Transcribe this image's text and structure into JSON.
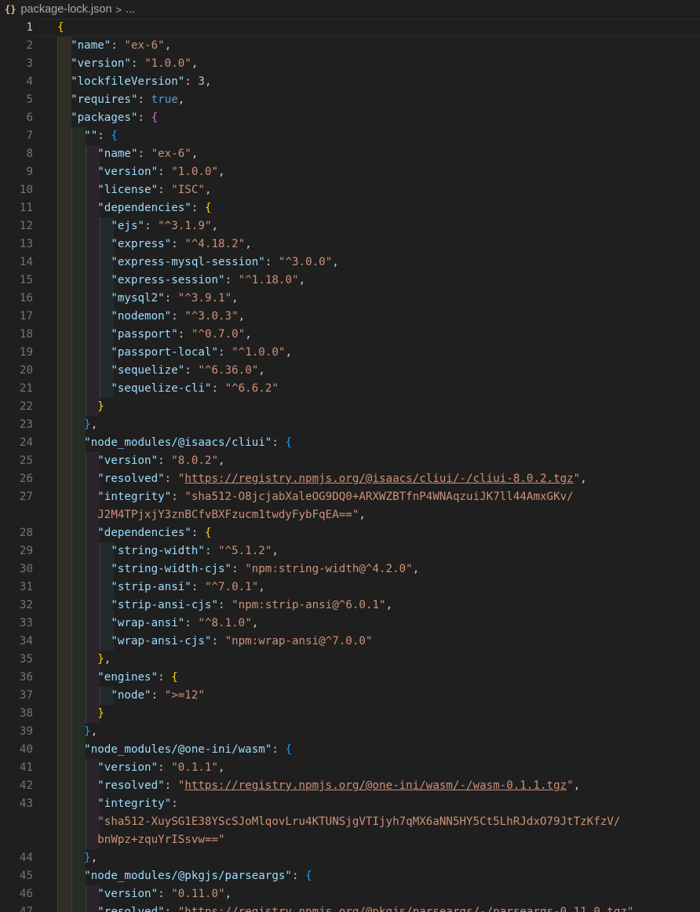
{
  "breadcrumb": {
    "icon": "{}",
    "file": "package-lock.json",
    "separator": ">",
    "more": "..."
  },
  "lines": [
    {
      "n": "1",
      "d": 0,
      "active": true,
      "tokens": [
        [
          "br1",
          "{"
        ]
      ]
    },
    {
      "n": "2",
      "d": 1,
      "tokens": [
        [
          "k",
          "\"name\""
        ],
        [
          "p",
          ": "
        ],
        [
          "s",
          "\"ex-6\""
        ],
        [
          "p",
          ","
        ]
      ]
    },
    {
      "n": "3",
      "d": 1,
      "tokens": [
        [
          "k",
          "\"version\""
        ],
        [
          "p",
          ": "
        ],
        [
          "s",
          "\"1.0.0\""
        ],
        [
          "p",
          ","
        ]
      ]
    },
    {
      "n": "4",
      "d": 1,
      "tokens": [
        [
          "k",
          "\"lockfileVersion\""
        ],
        [
          "p",
          ": "
        ],
        [
          "n",
          "3"
        ],
        [
          "p",
          ","
        ]
      ]
    },
    {
      "n": "5",
      "d": 1,
      "tokens": [
        [
          "k",
          "\"requires\""
        ],
        [
          "p",
          ": "
        ],
        [
          "b",
          "true"
        ],
        [
          "p",
          ","
        ]
      ]
    },
    {
      "n": "6",
      "d": 1,
      "tokens": [
        [
          "k",
          "\"packages\""
        ],
        [
          "p",
          ": "
        ],
        [
          "br2",
          "{"
        ]
      ]
    },
    {
      "n": "7",
      "d": 2,
      "tokens": [
        [
          "k",
          "\"\""
        ],
        [
          "p",
          ": "
        ],
        [
          "br3",
          "{"
        ]
      ]
    },
    {
      "n": "8",
      "d": 3,
      "tokens": [
        [
          "k",
          "\"name\""
        ],
        [
          "p",
          ": "
        ],
        [
          "s",
          "\"ex-6\""
        ],
        [
          "p",
          ","
        ]
      ]
    },
    {
      "n": "9",
      "d": 3,
      "tokens": [
        [
          "k",
          "\"version\""
        ],
        [
          "p",
          ": "
        ],
        [
          "s",
          "\"1.0.0\""
        ],
        [
          "p",
          ","
        ]
      ]
    },
    {
      "n": "10",
      "d": 3,
      "tokens": [
        [
          "k",
          "\"license\""
        ],
        [
          "p",
          ": "
        ],
        [
          "s",
          "\"ISC\""
        ],
        [
          "p",
          ","
        ]
      ]
    },
    {
      "n": "11",
      "d": 3,
      "tokens": [
        [
          "k",
          "\"dependencies\""
        ],
        [
          "p",
          ": "
        ],
        [
          "br1",
          "{"
        ]
      ]
    },
    {
      "n": "12",
      "d": 4,
      "tokens": [
        [
          "k",
          "\"ejs\""
        ],
        [
          "p",
          ": "
        ],
        [
          "s",
          "\"^3.1.9\""
        ],
        [
          "p",
          ","
        ]
      ]
    },
    {
      "n": "13",
      "d": 4,
      "tokens": [
        [
          "k",
          "\"express\""
        ],
        [
          "p",
          ": "
        ],
        [
          "s",
          "\"^4.18.2\""
        ],
        [
          "p",
          ","
        ]
      ]
    },
    {
      "n": "14",
      "d": 4,
      "tokens": [
        [
          "k",
          "\"express-mysql-session\""
        ],
        [
          "p",
          ": "
        ],
        [
          "s",
          "\"^3.0.0\""
        ],
        [
          "p",
          ","
        ]
      ]
    },
    {
      "n": "15",
      "d": 4,
      "tokens": [
        [
          "k",
          "\"express-session\""
        ],
        [
          "p",
          ": "
        ],
        [
          "s",
          "\"^1.18.0\""
        ],
        [
          "p",
          ","
        ]
      ]
    },
    {
      "n": "16",
      "d": 4,
      "tokens": [
        [
          "k",
          "\"mysql2\""
        ],
        [
          "p",
          ": "
        ],
        [
          "s",
          "\"^3.9.1\""
        ],
        [
          "p",
          ","
        ]
      ]
    },
    {
      "n": "17",
      "d": 4,
      "tokens": [
        [
          "k",
          "\"nodemon\""
        ],
        [
          "p",
          ": "
        ],
        [
          "s",
          "\"^3.0.3\""
        ],
        [
          "p",
          ","
        ]
      ]
    },
    {
      "n": "18",
      "d": 4,
      "tokens": [
        [
          "k",
          "\"passport\""
        ],
        [
          "p",
          ": "
        ],
        [
          "s",
          "\"^0.7.0\""
        ],
        [
          "p",
          ","
        ]
      ]
    },
    {
      "n": "19",
      "d": 4,
      "tokens": [
        [
          "k",
          "\"passport-local\""
        ],
        [
          "p",
          ": "
        ],
        [
          "s",
          "\"^1.0.0\""
        ],
        [
          "p",
          ","
        ]
      ]
    },
    {
      "n": "20",
      "d": 4,
      "tokens": [
        [
          "k",
          "\"sequelize\""
        ],
        [
          "p",
          ": "
        ],
        [
          "s",
          "\"^6.36.0\""
        ],
        [
          "p",
          ","
        ]
      ]
    },
    {
      "n": "21",
      "d": 4,
      "tokens": [
        [
          "k",
          "\"sequelize-cli\""
        ],
        [
          "p",
          ": "
        ],
        [
          "s",
          "\"^6.6.2\""
        ]
      ]
    },
    {
      "n": "22",
      "d": 3,
      "tokens": [
        [
          "br1",
          "}"
        ]
      ]
    },
    {
      "n": "23",
      "d": 2,
      "tokens": [
        [
          "br3",
          "}"
        ],
        [
          "p",
          ","
        ]
      ]
    },
    {
      "n": "24",
      "d": 2,
      "tokens": [
        [
          "k",
          "\"node_modules/@isaacs/cliui\""
        ],
        [
          "p",
          ": "
        ],
        [
          "br3",
          "{"
        ]
      ]
    },
    {
      "n": "25",
      "d": 3,
      "tokens": [
        [
          "k",
          "\"version\""
        ],
        [
          "p",
          ": "
        ],
        [
          "s",
          "\"8.0.2\""
        ],
        [
          "p",
          ","
        ]
      ]
    },
    {
      "n": "26",
      "d": 3,
      "tokens": [
        [
          "k",
          "\"resolved\""
        ],
        [
          "p",
          ": "
        ],
        [
          "s",
          "\""
        ],
        [
          "su",
          "https://registry.npmjs.org/@isaacs/cliui/-/cliui-8.0.2.tgz"
        ],
        [
          "s",
          "\""
        ],
        [
          "p",
          ","
        ]
      ]
    },
    {
      "n": "27",
      "d": 3,
      "tokens": [
        [
          "k",
          "\"integrity\""
        ],
        [
          "p",
          ": "
        ],
        [
          "s",
          "\"sha512-O8jcjabXaleOG9DQ0+ARXWZBTfnP4WNAqzuiJK7ll44AmxGKv/"
        ]
      ],
      "wrap": [
        [
          "s",
          "J2M4TPjxjY3znBCfvBXFzucm1twdyFybFqEA==\""
        ],
        [
          "p",
          ","
        ]
      ]
    },
    {
      "n": "28",
      "d": 3,
      "tokens": [
        [
          "k",
          "\"dependencies\""
        ],
        [
          "p",
          ": "
        ],
        [
          "br1",
          "{"
        ]
      ]
    },
    {
      "n": "29",
      "d": 4,
      "tokens": [
        [
          "k",
          "\"string-width\""
        ],
        [
          "p",
          ": "
        ],
        [
          "s",
          "\"^5.1.2\""
        ],
        [
          "p",
          ","
        ]
      ]
    },
    {
      "n": "30",
      "d": 4,
      "tokens": [
        [
          "k",
          "\"string-width-cjs\""
        ],
        [
          "p",
          ": "
        ],
        [
          "s",
          "\"npm:string-width@^4.2.0\""
        ],
        [
          "p",
          ","
        ]
      ]
    },
    {
      "n": "31",
      "d": 4,
      "tokens": [
        [
          "k",
          "\"strip-ansi\""
        ],
        [
          "p",
          ": "
        ],
        [
          "s",
          "\"^7.0.1\""
        ],
        [
          "p",
          ","
        ]
      ]
    },
    {
      "n": "32",
      "d": 4,
      "tokens": [
        [
          "k",
          "\"strip-ansi-cjs\""
        ],
        [
          "p",
          ": "
        ],
        [
          "s",
          "\"npm:strip-ansi@^6.0.1\""
        ],
        [
          "p",
          ","
        ]
      ]
    },
    {
      "n": "33",
      "d": 4,
      "tokens": [
        [
          "k",
          "\"wrap-ansi\""
        ],
        [
          "p",
          ": "
        ],
        [
          "s",
          "\"^8.1.0\""
        ],
        [
          "p",
          ","
        ]
      ]
    },
    {
      "n": "34",
      "d": 4,
      "tokens": [
        [
          "k",
          "\"wrap-ansi-cjs\""
        ],
        [
          "p",
          ": "
        ],
        [
          "s",
          "\"npm:wrap-ansi@^7.0.0\""
        ]
      ]
    },
    {
      "n": "35",
      "d": 3,
      "tokens": [
        [
          "br1",
          "}"
        ],
        [
          "p",
          ","
        ]
      ]
    },
    {
      "n": "36",
      "d": 3,
      "tokens": [
        [
          "k",
          "\"engines\""
        ],
        [
          "p",
          ": "
        ],
        [
          "br1",
          "{"
        ]
      ]
    },
    {
      "n": "37",
      "d": 4,
      "tokens": [
        [
          "k",
          "\"node\""
        ],
        [
          "p",
          ": "
        ],
        [
          "s",
          "\">=12\""
        ]
      ]
    },
    {
      "n": "38",
      "d": 3,
      "tokens": [
        [
          "br1",
          "}"
        ]
      ]
    },
    {
      "n": "39",
      "d": 2,
      "tokens": [
        [
          "br3",
          "}"
        ],
        [
          "p",
          ","
        ]
      ]
    },
    {
      "n": "40",
      "d": 2,
      "tokens": [
        [
          "k",
          "\"node_modules/@one-ini/wasm\""
        ],
        [
          "p",
          ": "
        ],
        [
          "br3",
          "{"
        ]
      ]
    },
    {
      "n": "41",
      "d": 3,
      "tokens": [
        [
          "k",
          "\"version\""
        ],
        [
          "p",
          ": "
        ],
        [
          "s",
          "\"0.1.1\""
        ],
        [
          "p",
          ","
        ]
      ]
    },
    {
      "n": "42",
      "d": 3,
      "tokens": [
        [
          "k",
          "\"resolved\""
        ],
        [
          "p",
          ": "
        ],
        [
          "s",
          "\""
        ],
        [
          "su",
          "https://registry.npmjs.org/@one-ini/wasm/-/wasm-0.1.1.tgz"
        ],
        [
          "s",
          "\""
        ],
        [
          "p",
          ","
        ]
      ]
    },
    {
      "n": "43",
      "d": 3,
      "tokens": [
        [
          "k",
          "\"integrity\""
        ],
        [
          "p",
          ":"
        ]
      ],
      "wrap": [
        [
          "s",
          "\"sha512-XuySG1E38YScSJoMlqovLru4KTUNSjgVTIjyh7qMX6aNN5HY5Ct5LhRJdxO79JtTzKfzV/"
        ]
      ],
      "wrap2": [
        [
          "s",
          "bnWpz+zquYrISsvw==\""
        ]
      ]
    },
    {
      "n": "44",
      "d": 2,
      "tokens": [
        [
          "br3",
          "}"
        ],
        [
          "p",
          ","
        ]
      ]
    },
    {
      "n": "45",
      "d": 2,
      "tokens": [
        [
          "k",
          "\"node_modules/@pkgjs/parseargs\""
        ],
        [
          "p",
          ": "
        ],
        [
          "br3",
          "{"
        ]
      ]
    },
    {
      "n": "46",
      "d": 3,
      "tokens": [
        [
          "k",
          "\"version\""
        ],
        [
          "p",
          ": "
        ],
        [
          "s",
          "\"0.11.0\""
        ],
        [
          "p",
          ","
        ]
      ]
    },
    {
      "n": "47",
      "d": 3,
      "tokens": [
        [
          "k",
          "\"resolved\""
        ],
        [
          "p",
          ": "
        ],
        [
          "s",
          "\"https://registry.npmjs.org/@pkgjs/parseargs/-/parseargs-0.11.0.tgz\""
        ],
        [
          "p",
          ","
        ]
      ]
    }
  ]
}
